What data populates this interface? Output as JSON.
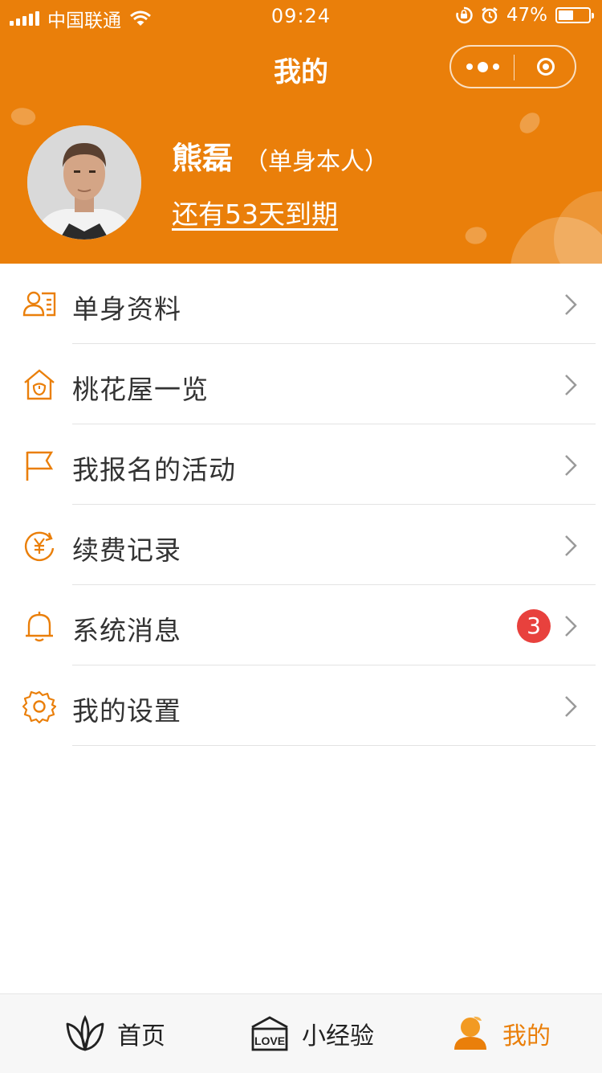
{
  "status_bar": {
    "carrier": "中国联通",
    "time": "09:24",
    "battery": "47%",
    "battery_level": 0.47
  },
  "nav": {
    "title": "我的"
  },
  "profile": {
    "name": "熊磊",
    "tag": "（单身本人）",
    "expiry": "还有53天到期"
  },
  "menu": {
    "items": [
      {
        "label": "单身资料",
        "icon": "profile-card-icon"
      },
      {
        "label": "桃花屋一览",
        "icon": "peach-house-icon"
      },
      {
        "label": "我报名的活动",
        "icon": "flag-icon"
      },
      {
        "label": "续费记录",
        "icon": "yuan-renew-icon"
      },
      {
        "label": "系统消息",
        "icon": "bell-icon",
        "badge": "3"
      },
      {
        "label": "我的设置",
        "icon": "gear-icon"
      }
    ]
  },
  "tabbar": {
    "tabs": [
      {
        "label": "首页",
        "icon": "leaf-icon"
      },
      {
        "label": "小经验",
        "icon": "love-house-icon",
        "icon_text": "LOVE"
      },
      {
        "label": "我的",
        "icon": "user-icon",
        "active": true
      }
    ]
  },
  "colors": {
    "accent": "#ea7f0a",
    "badge": "#e8413d",
    "text": "#333333"
  }
}
